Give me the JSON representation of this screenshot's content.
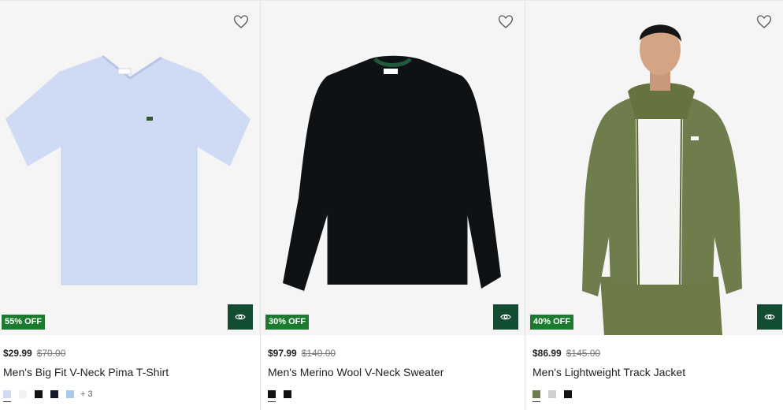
{
  "products": [
    {
      "price": "$29.99",
      "original_price": "$70.00",
      "name": "Men's Big Fit V-Neck Pima T-Shirt",
      "discount": "55% OFF",
      "swatches": [
        "#cfdaf3",
        "#f2f2f2",
        "#121212",
        "#141a2c",
        "#a4cbef"
      ],
      "more_colors": "+ 3",
      "product_color": "#cfdbf4"
    },
    {
      "price": "$97.99",
      "original_price": "$140.00",
      "name": "Men's Merino Wool V-Neck Sweater",
      "discount": "30% OFF",
      "swatches": [
        "#121212",
        "#101010"
      ],
      "product_color": "#0f1214"
    },
    {
      "price": "$86.99",
      "original_price": "$145.00",
      "name": "Men's Lightweight Track Jacket",
      "discount": "40% OFF",
      "swatches": [
        "#6d7c4b",
        "#cfcfcf",
        "#121212"
      ],
      "product_color": "#6f7d4d"
    }
  ],
  "colors": {
    "badge_green": "#1b7a2e",
    "quick_view_green": "#124d32",
    "text": "#222222"
  },
  "icons": {
    "wishlist": "heart-outline-icon",
    "quick_view": "eye-icon"
  }
}
